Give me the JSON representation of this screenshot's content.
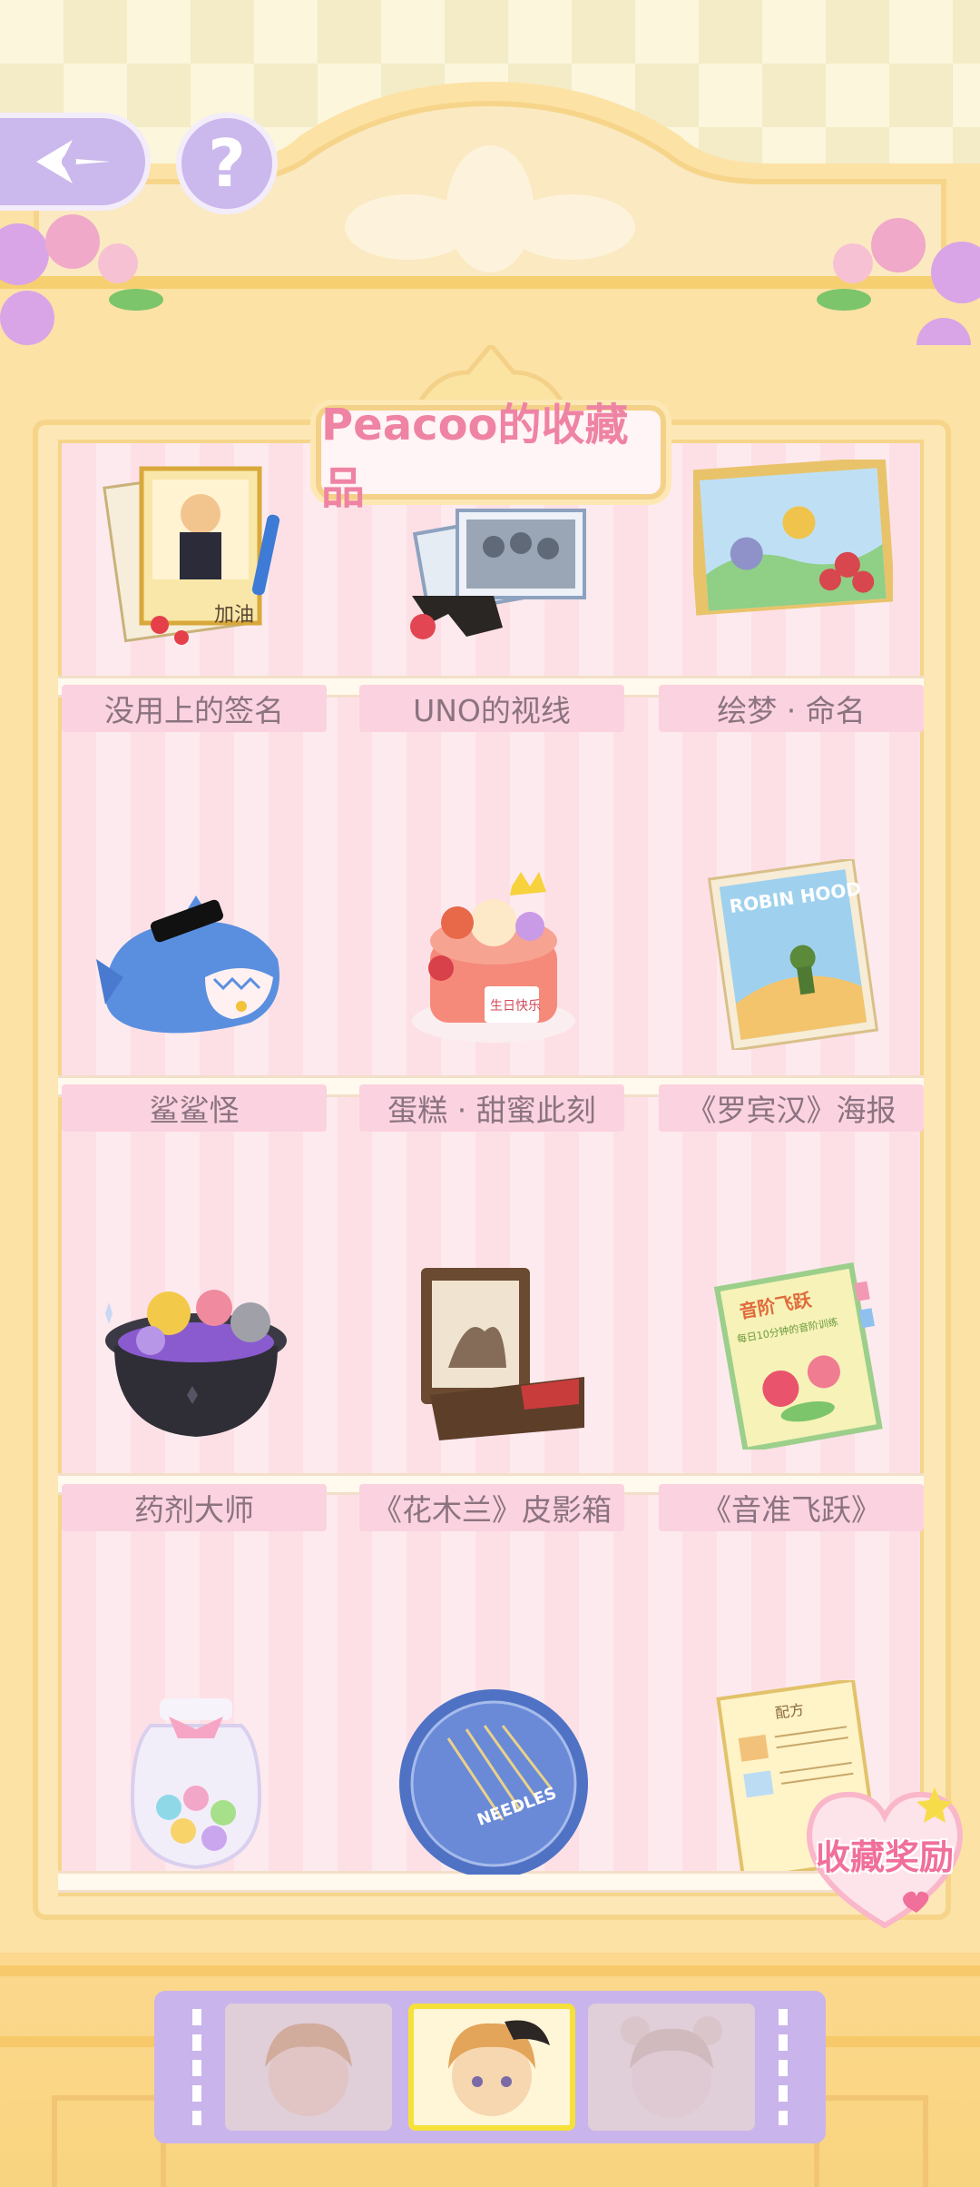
{
  "header": {
    "back_icon": "back-arrow-icon",
    "help_label": "?"
  },
  "collection": {
    "title": "Peacoo的收藏品",
    "items": [
      {
        "label": "没用上的签名",
        "icon": "autograph-photo-icon"
      },
      {
        "label": "UNO的视线",
        "icon": "photos-sunglasses-icon"
      },
      {
        "label": "绘梦 · 命名",
        "icon": "painting-icon"
      },
      {
        "label": "鲨鲨怪",
        "icon": "shark-plush-icon"
      },
      {
        "label": "蛋糕 · 甜蜜此刻",
        "icon": "birthday-cake-icon"
      },
      {
        "label": "《罗宾汉》海报",
        "icon": "robin-hood-poster-icon"
      },
      {
        "label": "药剂大师",
        "icon": "potion-cauldron-icon"
      },
      {
        "label": "《花木兰》皮影箱",
        "icon": "shadow-puppet-box-icon"
      },
      {
        "label": "《音准飞跃》",
        "icon": "music-book-icon"
      },
      {
        "label": "",
        "icon": "candy-jar-icon"
      },
      {
        "label": "",
        "icon": "needles-tin-icon"
      },
      {
        "label": "",
        "icon": "recipe-note-icon"
      }
    ]
  },
  "art_text": {
    "autograph_note": "加油",
    "poster_title": "ROBIN HOOD",
    "book_title": "音阶飞跃",
    "book_sub": "每日10分钟的音阶训练",
    "cake_sign": "生日快乐",
    "tin_label": "NEEDLES",
    "recipe_title": "配方"
  },
  "reward": {
    "label": "收藏奖励"
  },
  "selector": {
    "characters": [
      "character-portrait-1",
      "character-portrait-peacoo",
      "character-portrait-3"
    ],
    "active_index": 1
  },
  "colors": {
    "accent_pink": "#ef83a4",
    "label_bg": "#fbd2df",
    "cabinet": "#fde2a6",
    "selector": "#c9b4ec"
  }
}
